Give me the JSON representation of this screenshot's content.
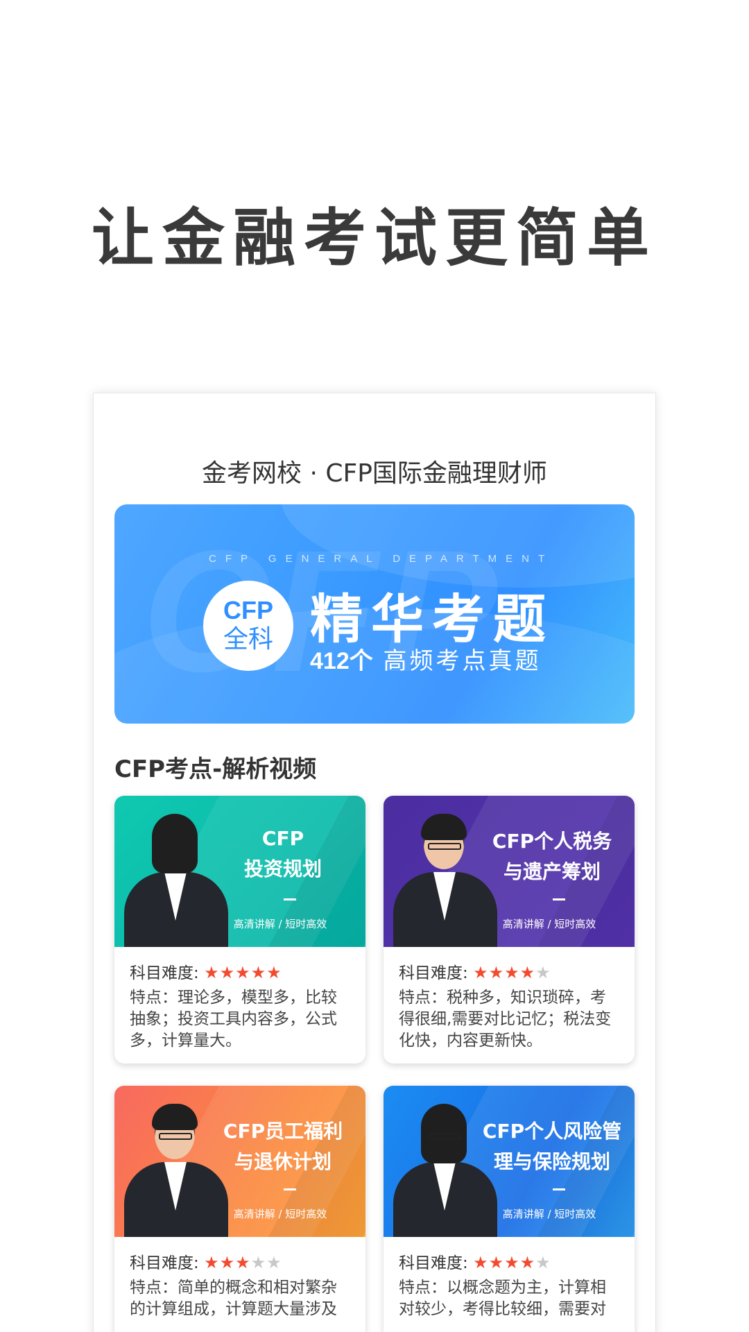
{
  "headline": "让金融考试更简单",
  "panel": {
    "title": "金考网校 · CFP国际金融理财师",
    "banner": {
      "watermark": "CFP",
      "department": "CFP GENERAL DEPARTMENT",
      "badge_line1": "CFP",
      "badge_line2": "全科",
      "main": "精华考题",
      "sub_count": "412个",
      "sub_text": " 高频考点真题"
    },
    "section_title": "CFP考点-解析视频",
    "difficulty_label": "科目难度:",
    "cards": [
      {
        "title_line1": "CFP",
        "title_line2": "投资规划",
        "tag": "高清讲解 / 短时高效",
        "stars": 5,
        "features": "特点：理论多，模型多，比较抽象；投资工具内容多，公式多，计算量大。"
      },
      {
        "title_line1": "CFP个人税务",
        "title_line2": "与遗产筹划",
        "tag": "高清讲解 / 短时高效",
        "stars": 4,
        "features": "特点：税种多，知识琐碎，考得很细,需要对比记忆；税法变化快，内容更新快。"
      },
      {
        "title_line1": "CFP员工福利",
        "title_line2": "与退休计划",
        "tag": "高清讲解 / 短时高效",
        "stars": 3,
        "features": "特点：简单的概念和相对繁杂的计算组成，计算题大量涉及"
      },
      {
        "title_line1": "CFP个人风险管",
        "title_line2": "理与保险规划",
        "tag": "高清讲解 / 短时高效",
        "stars": 4,
        "features": "特点：以概念题为主，计算相对较少，考得比较细，需要对"
      }
    ],
    "star_on_color": "#f24b2f",
    "star_off_color": "#c8c8c8"
  }
}
